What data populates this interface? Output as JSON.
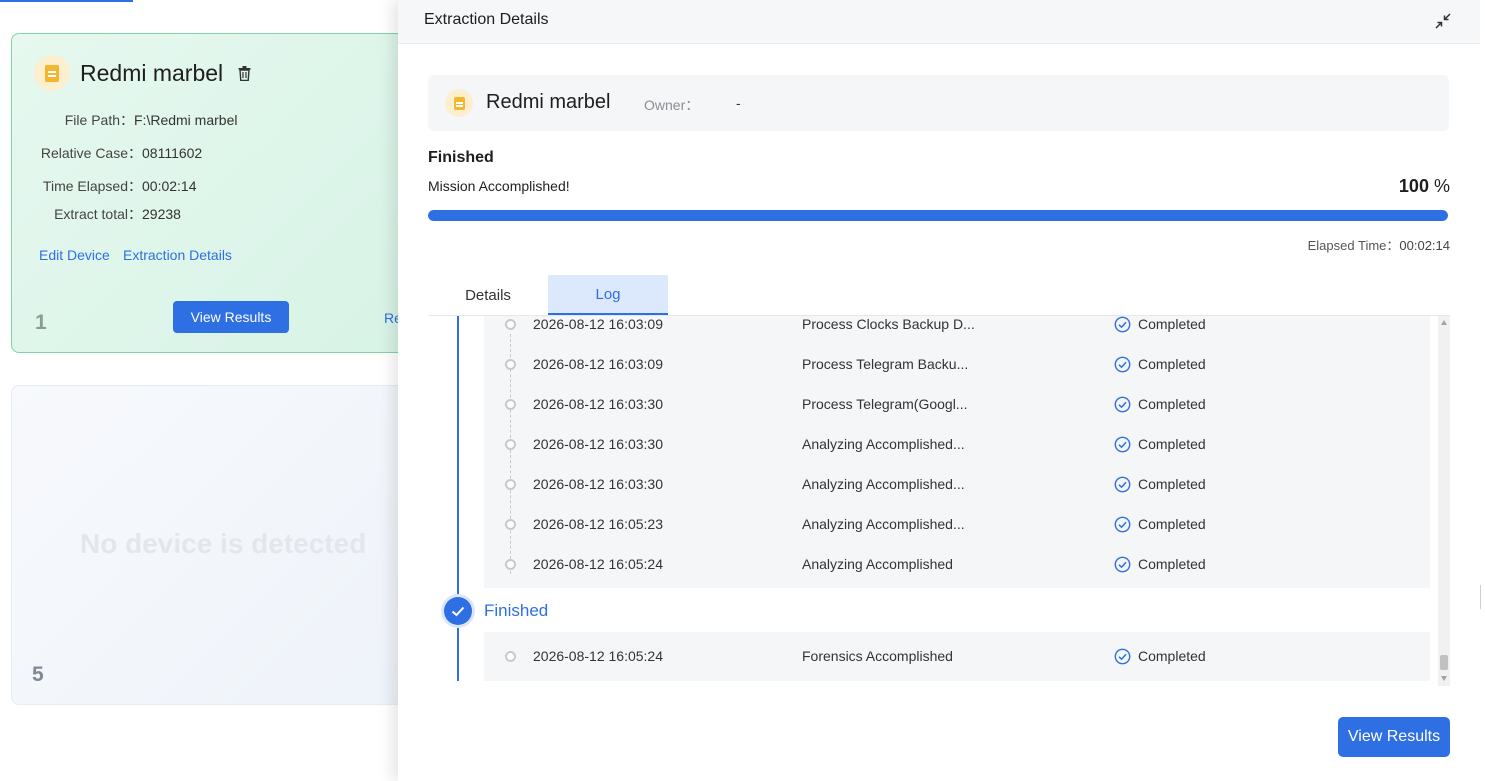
{
  "device_card": {
    "title": "Redmi marbel",
    "fields": [
      {
        "label": "File Path：",
        "value": "F:\\Redmi marbel"
      },
      {
        "label": "Relative Case：",
        "value": "08111602"
      },
      {
        "label": "Time Elapsed：",
        "value": "00:02:14"
      },
      {
        "label": "Extract total：",
        "value": "29238"
      }
    ],
    "links": {
      "edit": "Edit Device",
      "details": "Extraction Details"
    },
    "index": "1",
    "view_results": "View Results",
    "extra_link": "Re"
  },
  "empty_card": {
    "text": "No device is detected",
    "index": "5"
  },
  "drawer": {
    "title": "Extraction Details",
    "device": {
      "name": "Redmi marbel",
      "owner_label": "Owner：",
      "owner_value": "-"
    },
    "status": {
      "title": "Finished",
      "message": "Mission Accomplished!",
      "percent": "100",
      "percent_unit": "%",
      "progress": 100,
      "elapsed_label": "Elapsed Time：",
      "elapsed_value": "00:02:14"
    },
    "tabs": [
      {
        "label": "Details",
        "active": false
      },
      {
        "label": "Log",
        "active": true
      }
    ],
    "log": {
      "rows": [
        {
          "time": "2026-08-12 16:03:09",
          "desc": "Process Clocks Backup D...",
          "status": "Completed"
        },
        {
          "time": "2026-08-12 16:03:09",
          "desc": "Process Telegram Backu...",
          "status": "Completed"
        },
        {
          "time": "2026-08-12 16:03:30",
          "desc": "Process Telegram(Googl...",
          "status": "Completed"
        },
        {
          "time": "2026-08-12 16:03:30",
          "desc": "Analyzing Accomplished...",
          "status": "Completed"
        },
        {
          "time": "2026-08-12 16:03:30",
          "desc": "Analyzing Accomplished...",
          "status": "Completed"
        },
        {
          "time": "2026-08-12 16:05:23",
          "desc": "Analyzing Accomplished...",
          "status": "Completed"
        },
        {
          "time": "2026-08-12 16:05:24",
          "desc": "Analyzing Accomplished",
          "status": "Completed"
        }
      ],
      "finished_group": {
        "label": "Finished",
        "rows": [
          {
            "time": "2026-08-12 16:05:24",
            "desc": "Forensics Accomplished",
            "status": "Completed"
          }
        ]
      }
    },
    "view_results": "View Results"
  },
  "colors": {
    "accent": "#2f6fe4",
    "card_border": "#7fd4a8",
    "card_corner": "#1fbf6b"
  },
  "icons": [
    "file-icon",
    "trash-icon",
    "collapse-icon",
    "check-circle-icon",
    "checkmark-icon"
  ]
}
